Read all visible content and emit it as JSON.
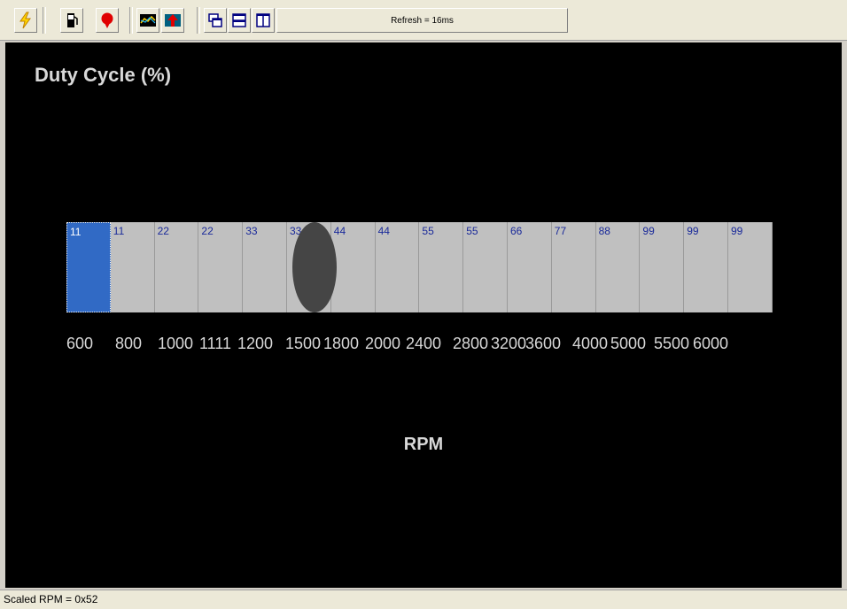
{
  "toolbar": {
    "refresh_label": "Refresh = 16ms",
    "buttons": [
      {
        "icon": "flash-icon"
      },
      {
        "icon": "fuel-pump-icon"
      },
      {
        "icon": "red-pin-icon"
      },
      {
        "icon": "graph-icon"
      },
      {
        "icon": "graph-up-icon"
      },
      {
        "icon": "cascade-windows-icon"
      },
      {
        "icon": "tile-horizontal-icon"
      },
      {
        "icon": "tile-vertical-icon"
      }
    ]
  },
  "main": {
    "title": "Duty Cycle (%)",
    "xlabel": "RPM",
    "cells": [
      "11",
      "11",
      "22",
      "22",
      "33",
      "33",
      "44",
      "44",
      "55",
      "55",
      "66",
      "77",
      "88",
      "99",
      "99",
      "99"
    ],
    "rpm_ticks": [
      "600",
      "800",
      "1000",
      "1111",
      "1200",
      "1500",
      "1800",
      "2000",
      "2400",
      "2800",
      "3200",
      "3600",
      "4000",
      "5000",
      "5500",
      "6000"
    ],
    "active_index": 0
  },
  "colors": {
    "background": "#000000",
    "cell": "#c0c0c0",
    "active_cell": "#316ac5",
    "value_text": "#1a2a9a",
    "cursor": "#454545"
  },
  "status": {
    "text": "Scaled RPM = 0x52"
  }
}
